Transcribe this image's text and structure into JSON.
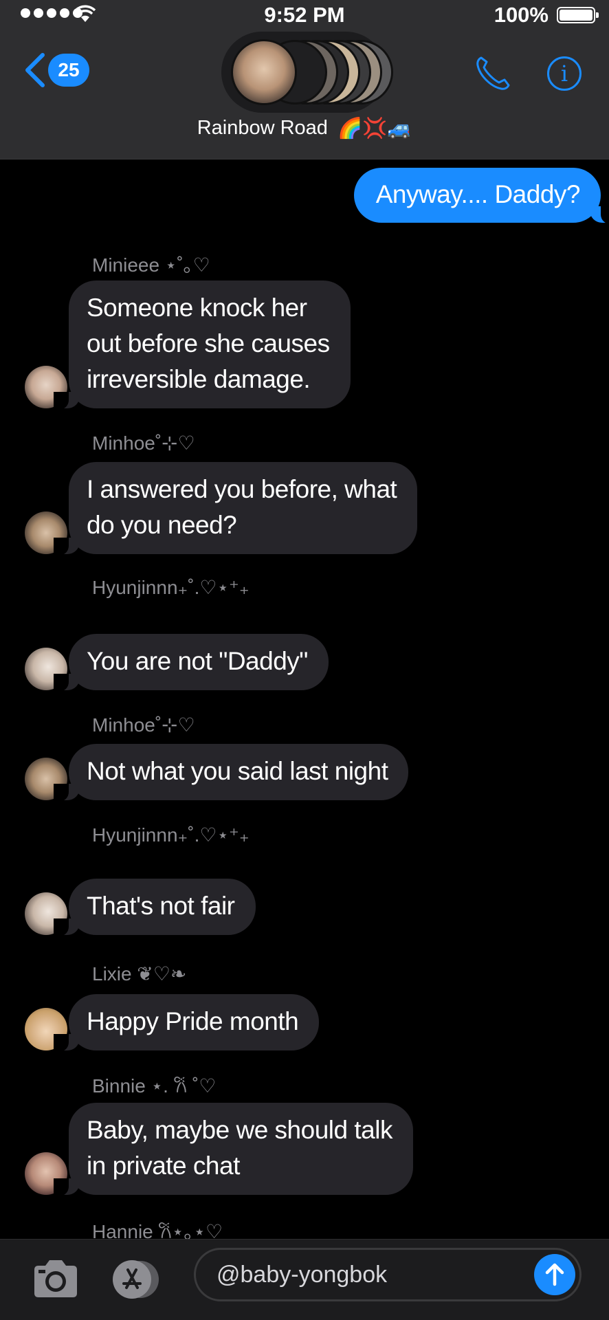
{
  "status": {
    "time": "9:52 PM",
    "battery": "100%"
  },
  "header": {
    "back_count": "25",
    "group_name": "Rainbow Road",
    "group_emoji": "🌈💢🚙"
  },
  "messages": {
    "outgoing": "Anyway.... Daddy?",
    "m1": {
      "sender": "Minieee ⋆˚｡♡",
      "text_lines": [
        "Someone knock her",
        "out before she causes",
        "irreversible damage."
      ]
    },
    "m2": {
      "sender": "Minhoe˚⊹♡",
      "text_lines": [
        "I answered you before, what",
        "do you need?"
      ]
    },
    "m3": {
      "sender": "Hyunjinnn₊˚.♡⋆⁺₊",
      "text": "You are not \"Daddy\""
    },
    "m4": {
      "sender": "Minhoe˚⊹♡",
      "text": "Not what you said last night"
    },
    "m5": {
      "sender": "Hyunjinnn₊˚.♡⋆⁺₊",
      "text": "That's not fair"
    },
    "m6": {
      "sender": "Lixie ❦♡❧",
      "text": "Happy Pride month"
    },
    "m7": {
      "sender": "Binnie ⋆. 𐙚 ˚♡",
      "text_lines": [
        "Baby, maybe we should talk",
        "in private chat"
      ]
    },
    "m8": {
      "sender": "Hannie 𐙚⋆｡⋆♡"
    }
  },
  "composer": {
    "value": "@baby-yongbok"
  },
  "colors": {
    "accent": "#1a8cff",
    "incoming_bubble": "#26252a",
    "header_bg": "#2e2e30"
  }
}
